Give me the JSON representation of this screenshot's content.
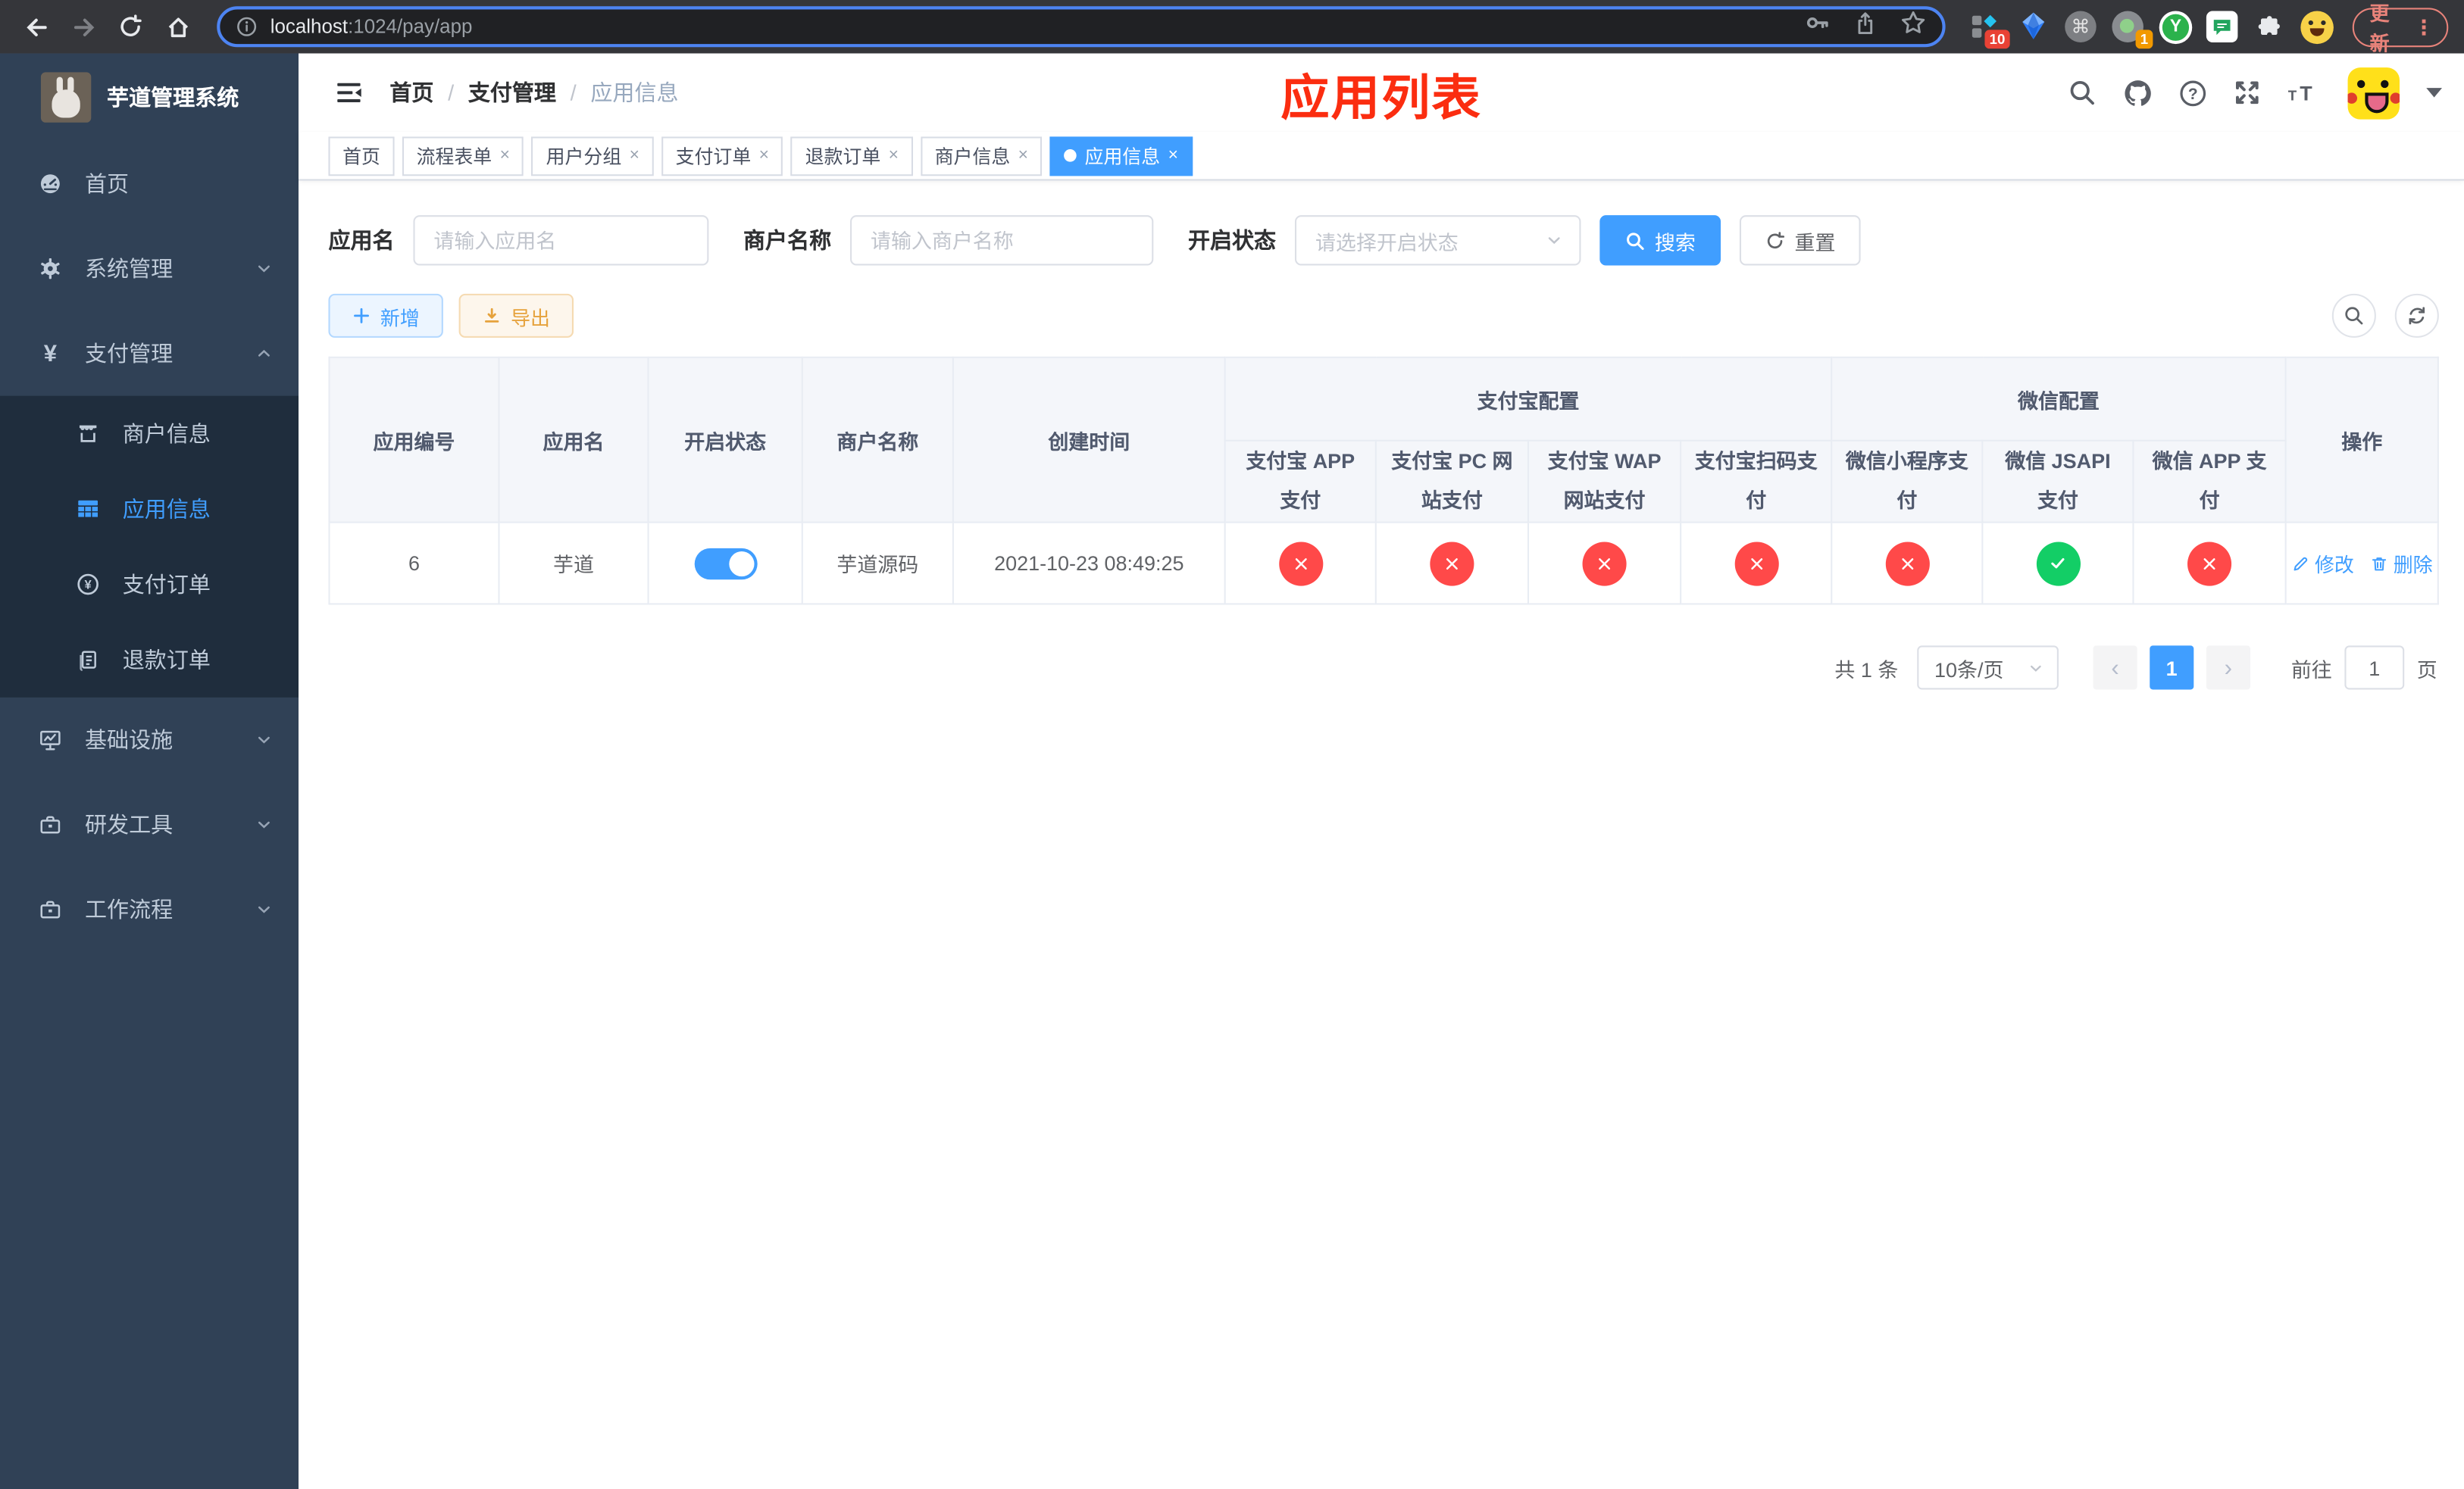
{
  "browser": {
    "url_domain": "localhost",
    "url_path": ":1024/pay/app",
    "update_label": "更新",
    "ext_badge_a": "10",
    "ext_badge_b": "1",
    "ext_y_glyph": "Y"
  },
  "ui": {
    "close_glyph": "×",
    "breadcrumb_sep": "/",
    "kebab_glyph": "⋮",
    "prev_glyph": "‹",
    "next_glyph": "›"
  },
  "sidebar": {
    "title": "芋道管理系统",
    "items": [
      {
        "label": "首页"
      },
      {
        "label": "系统管理"
      },
      {
        "label": "支付管理"
      },
      {
        "label": "商户信息"
      },
      {
        "label": "应用信息"
      },
      {
        "label": "支付订单"
      },
      {
        "label": "退款订单"
      },
      {
        "label": "基础设施"
      },
      {
        "label": "研发工具"
      },
      {
        "label": "工作流程"
      }
    ]
  },
  "header": {
    "breadcrumb": [
      {
        "label": "首页"
      },
      {
        "label": "支付管理"
      },
      {
        "label": "应用信息"
      }
    ],
    "annotation": "应用列表"
  },
  "tabs": [
    {
      "label": "首页"
    },
    {
      "label": "流程表单"
    },
    {
      "label": "用户分组"
    },
    {
      "label": "支付订单"
    },
    {
      "label": "退款订单"
    },
    {
      "label": "商户信息"
    },
    {
      "label": "应用信息"
    }
  ],
  "filters": {
    "app_name_label": "应用名",
    "app_name_placeholder": "请输入应用名",
    "merchant_label": "商户名称",
    "merchant_placeholder": "请输入商户名称",
    "status_label": "开启状态",
    "status_placeholder": "请选择开启状态",
    "search_label": "搜索",
    "reset_label": "重置"
  },
  "toolbar": {
    "add_label": "新增",
    "export_label": "导出"
  },
  "table": {
    "head": {
      "id": "应用编号",
      "name": "应用名",
      "status": "开启状态",
      "merchant": "商户名称",
      "created": "创建时间",
      "alipay_group": "支付宝配置",
      "wechat_group": "微信配置",
      "ops": "操作",
      "subs": [
        "支付宝 APP 支付",
        "支付宝 PC 网站支付",
        "支付宝 WAP 网站支付",
        "支付宝扫码支付",
        "微信小程序支付",
        "微信 JSAPI 支付",
        "微信 APP 支付"
      ]
    },
    "row": {
      "id": "6",
      "name": "芋道",
      "merchant": "芋道源码",
      "created": "2021-10-23 08:49:25",
      "switch_on": true,
      "statuses": [
        false,
        false,
        false,
        false,
        false,
        true,
        false
      ],
      "edit_label": "修改",
      "delete_label": "删除"
    }
  },
  "pagination": {
    "total": "共 1 条",
    "size": "10条/页",
    "page": "1",
    "goto_label": "前往",
    "goto_value": "1",
    "unit": "页"
  },
  "colors": {
    "primary": "#409eff",
    "success": "#13ce66",
    "danger": "#ff4949",
    "warning": "#e6a23c",
    "sidebar_bg": "#304156",
    "submenu_bg": "#1f2d3d"
  }
}
